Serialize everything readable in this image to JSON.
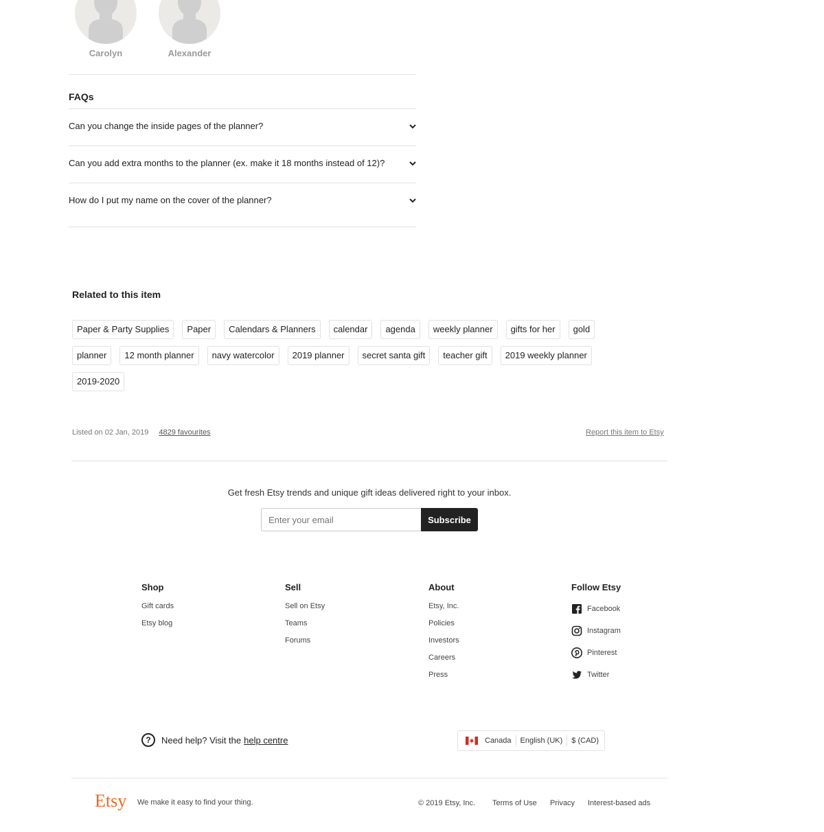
{
  "reviewers": [
    "Carolyn",
    "Alexander"
  ],
  "faq": {
    "title": "FAQs",
    "items": [
      "Can you change the inside pages of the planner?",
      "Can you add extra months to the planner (ex. make it 18 months instead of 12)?",
      "How do I put my name on the cover of the planner?"
    ]
  },
  "related": {
    "title": "Related to this item",
    "tags": [
      "Paper & Party Supplies",
      "Paper",
      "Calendars & Planners",
      "calendar",
      "agenda",
      "weekly planner",
      "gifts for her",
      "gold",
      "planner",
      "12 month planner",
      "navy watercolor",
      "2019 planner",
      "secret santa gift",
      "teacher gift",
      "2019 weekly planner",
      "2019-2020"
    ]
  },
  "listing": {
    "listed_on": "Listed on 02 Jan, 2019",
    "favourites": "4829 favourites",
    "report": "Report this item to Etsy"
  },
  "newsletter": {
    "text": "Get fresh Etsy trends and unique gift ideas delivered right to your inbox.",
    "placeholder": "Enter your email",
    "button": "Subscribe"
  },
  "footer": {
    "shop": {
      "title": "Shop",
      "items": [
        "Gift cards",
        "Etsy blog"
      ]
    },
    "sell": {
      "title": "Sell",
      "items": [
        "Sell on Etsy",
        "Teams",
        "Forums"
      ]
    },
    "about": {
      "title": "About",
      "items": [
        "Etsy, Inc.",
        "Policies",
        "Investors",
        "Careers",
        "Press"
      ]
    },
    "follow": {
      "title": "Follow Etsy",
      "items": [
        "Facebook",
        "Instagram",
        "Pinterest",
        "Twitter"
      ]
    }
  },
  "help": {
    "prefix": "Need help? Visit the",
    "link": "help centre"
  },
  "locale": {
    "country": "Canada",
    "language": "English (UK)",
    "currency": "$ (CAD)"
  },
  "bottom": {
    "logo": "Etsy",
    "tagline": "We make it easy to find your thing.",
    "copyright": "© 2019 Etsy, Inc.",
    "terms": "Terms of Use",
    "privacy": "Privacy",
    "ads": "Interest-based ads"
  },
  "colors": {
    "brand": "#f1641e",
    "button_bg": "#222222",
    "border": "#e1e1e1"
  }
}
